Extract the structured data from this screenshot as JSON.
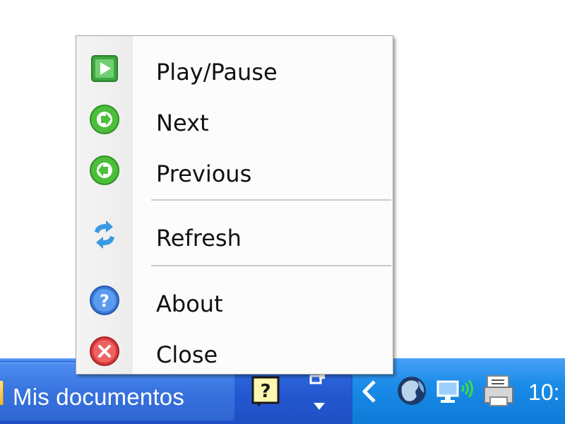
{
  "menu": {
    "items": [
      {
        "label": "Play/Pause",
        "icon": "play-icon"
      },
      {
        "label": "Next",
        "icon": "next-arrow-icon"
      },
      {
        "label": "Previous",
        "icon": "previous-arrow-icon"
      },
      {
        "label": "Refresh",
        "icon": "refresh-icon"
      },
      {
        "label": "About",
        "icon": "help-question-icon"
      },
      {
        "label": "Close",
        "icon": "close-x-icon"
      }
    ]
  },
  "taskbar": {
    "window_button_label": "Mis documentos",
    "clock_text": "10:",
    "tray_icons": [
      "help-app-icon",
      "mini-player-icon",
      "show-hidden-icons-chevron",
      "globe-icon",
      "network-icon",
      "printer-icon"
    ]
  },
  "colors": {
    "taskbar_blue": "#2458d0",
    "tray_blue": "#1a8ce8",
    "menu_background": "#fcfcfc",
    "play_green": "#3fa63f",
    "arrow_green": "#4cbf3a",
    "about_blue": "#3a7ad8",
    "close_red": "#d83a3a"
  }
}
